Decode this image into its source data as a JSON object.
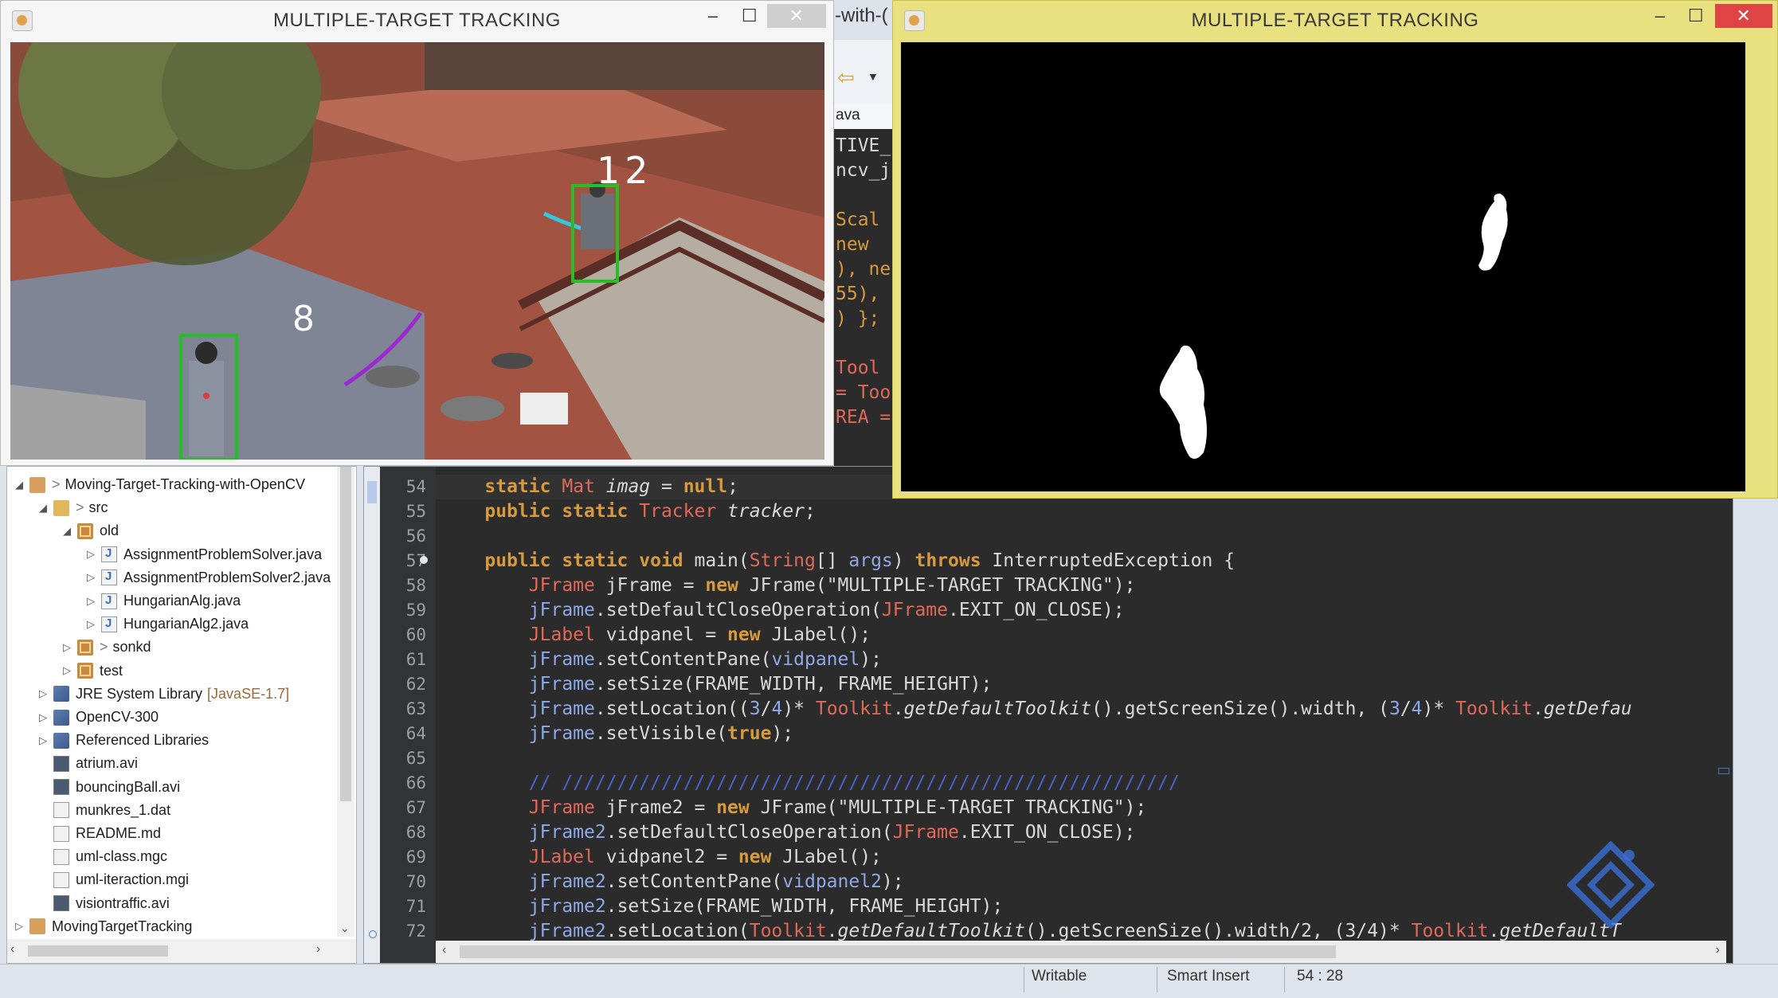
{
  "colors": {
    "editor_bg": "#2b2b2b",
    "titlebar_active": "#e9e07f",
    "titlebar_inactive": "#f6f6f6",
    "close_red": "#e04343",
    "tracker_green": "#22c022"
  },
  "window_left": {
    "title": "MULTIPLE-TARGET TRACKING",
    "buttons": {
      "minimize": "–",
      "maximize": "☐",
      "close": "✕"
    },
    "tracks": [
      {
        "id": "12"
      },
      {
        "id": "8"
      }
    ]
  },
  "window_right": {
    "title": "MULTIPLE-TARGET TRACKING",
    "buttons": {
      "minimize": "–",
      "maximize": "☐",
      "close": "✕"
    }
  },
  "eclipse_fragments": {
    "title_fragment": "-with-(",
    "tab_fragment": "ava",
    "code_fragments": [
      "TIVE_",
      "ncv_j",
      "",
      "Scal",
      "new",
      "), ne",
      "55),",
      ") };",
      "",
      "Tool",
      "= Too",
      "REA ="
    ]
  },
  "explorer": {
    "items": [
      {
        "label": "Moving-Target-Tracking-with-OpenCV",
        "decor": ">",
        "arrow": "◢",
        "icon": "proj",
        "indent": 0
      },
      {
        "label": "src",
        "decor": ">",
        "arrow": "◢",
        "icon": "folder",
        "indent": 1
      },
      {
        "label": "old",
        "decor": "",
        "arrow": "◢",
        "icon": "pkg",
        "indent": 2
      },
      {
        "label": "AssignmentProblemSolver.java",
        "decor": "",
        "arrow": "▷",
        "icon": "java",
        "indent": 3
      },
      {
        "label": "AssignmentProblemSolver2.java",
        "decor": "",
        "arrow": "▷",
        "icon": "java",
        "indent": 3
      },
      {
        "label": "HungarianAlg.java",
        "decor": "",
        "arrow": "▷",
        "icon": "java",
        "indent": 3
      },
      {
        "label": "HungarianAlg2.java",
        "decor": "",
        "arrow": "▷",
        "icon": "java",
        "indent": 3
      },
      {
        "label": "sonkd",
        "decor": ">",
        "arrow": "▷",
        "icon": "pkg",
        "indent": 2
      },
      {
        "label": "test",
        "decor": "",
        "arrow": "▷",
        "icon": "pkg",
        "indent": 2
      },
      {
        "label": "JRE System Library",
        "suffix": "[JavaSE-1.7]",
        "decor": "",
        "arrow": "▷",
        "icon": "lib",
        "indent": 1
      },
      {
        "label": "OpenCV-300",
        "decor": "",
        "arrow": "▷",
        "icon": "lib",
        "indent": 1
      },
      {
        "label": "Referenced Libraries",
        "decor": "",
        "arrow": "▷",
        "icon": "lib",
        "indent": 1
      },
      {
        "label": "atrium.avi",
        "decor": "",
        "arrow": "",
        "icon": "avi",
        "indent": 1
      },
      {
        "label": "bouncingBall.avi",
        "decor": "",
        "arrow": "",
        "icon": "avi",
        "indent": 1
      },
      {
        "label": "munkres_1.dat",
        "decor": "",
        "arrow": "",
        "icon": "file",
        "indent": 1
      },
      {
        "label": "README.md",
        "decor": "",
        "arrow": "",
        "icon": "file",
        "indent": 1
      },
      {
        "label": "uml-class.mgc",
        "decor": "",
        "arrow": "",
        "icon": "file",
        "indent": 1
      },
      {
        "label": "uml-iteraction.mgi",
        "decor": "",
        "arrow": "",
        "icon": "file",
        "indent": 1
      },
      {
        "label": "visiontraffic.avi",
        "decor": "",
        "arrow": "",
        "icon": "avi",
        "indent": 1
      },
      {
        "label": "MovingTargetTracking",
        "decor": "",
        "arrow": "▷",
        "icon": "proj",
        "indent": 0
      }
    ]
  },
  "editor": {
    "line_numbers": [
      "54",
      "55",
      "56",
      "57",
      "58",
      "59",
      "60",
      "61",
      "62",
      "63",
      "64",
      "65",
      "66",
      "67",
      "68",
      "69",
      "70",
      "71",
      "72"
    ],
    "lines": [
      "    <span class='kw'>static</span> <span class='ty'>Mat</span> <span class='it'>imag</span> = <span class='kw'>null</span>;",
      "    <span class='kw'>public static</span> <span class='ty'>Tracker</span> <span class='it'>tracker</span>;",
      "",
      "    <span class='kw'>public static void</span> main(<span class='ty'>String</span>[] <span class='fld'>args</span>) <span class='kw'>throws</span> InterruptedException {",
      "        <span class='ty'>JFrame</span> jFrame = <span class='kw'>new</span> JFrame(<span class='str'>\"MULTIPLE-TARGET TRACKING\"</span>);",
      "        <span class='fld'>jFrame</span>.setDefaultCloseOperation(<span class='ty'>JFrame</span>.EXIT_ON_CLOSE);",
      "        <span class='ty'>JLabel</span> vidpanel = <span class='kw'>new</span> JLabel();",
      "        <span class='fld'>jFrame</span>.setContentPane(<span class='fld'>vidpanel</span>);",
      "        <span class='fld'>jFrame</span>.setSize(FRAME_WIDTH, FRAME_HEIGHT);",
      "        <span class='fld'>jFrame</span>.setLocation((<span class='num'>3</span>/<span class='num'>4</span>)* <span class='ty'>Toolkit</span>.<span class='it'>getDefaultToolkit</span>().getScreenSize().width, (<span class='num'>3</span>/<span class='num'>4</span>)* <span class='ty'>Toolkit</span>.<span class='it'>getDefau</span>",
      "        <span class='fld'>jFrame</span>.setVisible(<span class='kw'>true</span>);",
      "",
      "        <span class='cm'>// ////////////////////////////////////////////////////////</span>",
      "        <span class='ty'>JFrame</span> jFrame2 = <span class='kw'>new</span> JFrame(<span class='str'>\"MULTIPLE-TARGET TRACKING\"</span>);",
      "        <span class='fld'>jFrame2</span>.setDefaultCloseOperation(<span class='ty'>JFrame</span>.EXIT_ON_CLOSE);",
      "        <span class='ty'>JLabel</span> vidpanel2 = <span class='kw'>new</span> JLabel();",
      "        <span class='fld'>jFrame2</span>.setContentPane(<span class='fld'>vidpanel2</span>);",
      "        <span class='fld'>jFrame2</span>.setSize(FRAME_WIDTH, FRAME_HEIGHT);",
      "        <span class='fld'>jFrame2</span>.setLocation(<span class='ty'>Toolkit</span>.<span class='it'>getDefaultToolkit</span>().getScreenSize().width/2, (3/4)* <span class='ty'>Toolkit</span>.<span class='it'>getDefaultT</span>"
    ]
  },
  "status_bar": {
    "mode": "Writable",
    "insert": "Smart Insert",
    "position": "54 : 28"
  }
}
